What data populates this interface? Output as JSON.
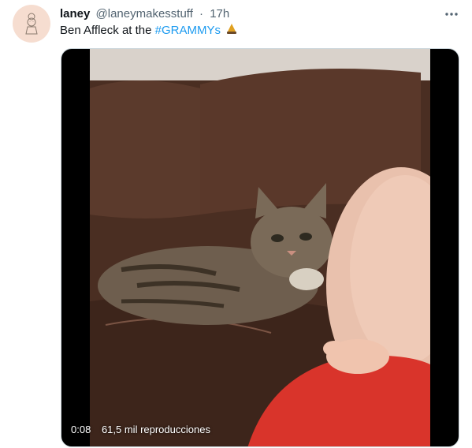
{
  "tweet": {
    "display_name": "laney",
    "handle": "@laneymakesstuff",
    "separator": "·",
    "time": "17h",
    "text_prefix": "Ben Affleck at the ",
    "hashtag": "#GRAMMYs",
    "emoji_icon": "gramophone-icon",
    "more_icon": "more-horizontal-icon"
  },
  "video": {
    "elapsed": "0:08",
    "views": "61,5 mil reproducciones"
  },
  "colors": {
    "hashtag": "#1d9bf0",
    "avatar_bg": "#f6ddd0",
    "text": "#0f1419",
    "secondary": "#536471"
  }
}
